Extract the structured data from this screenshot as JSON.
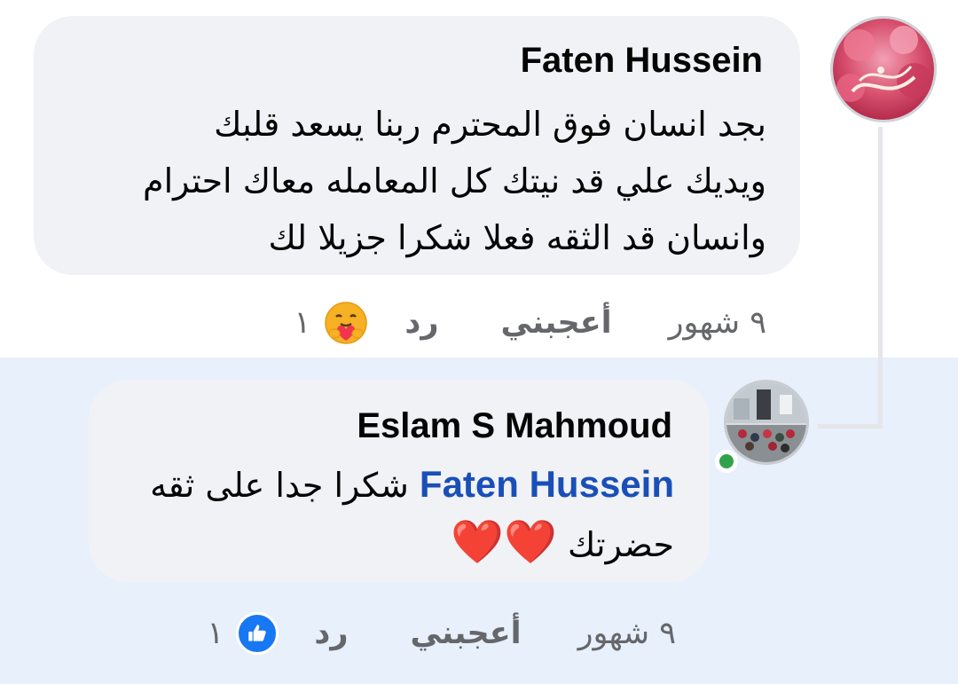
{
  "colors": {
    "bubble_bg": "#f0f2f5",
    "highlight_bg": "#e7f0fb",
    "meta_text": "#65676b",
    "mention": "#1a4fb8",
    "online": "#31a24c",
    "like_blue": "#1877f2"
  },
  "comments": [
    {
      "author": "Faten Hussein",
      "lines": [
        "بجد انسان فوق المحترم ربنا يسعد قلبك",
        "ويديك علي قد نيتك كل المعامله معاك  احترام",
        "وانسان قد الثقه فعلا شكرا جزيلا لك"
      ],
      "time": "٩ شهور",
      "like_label": "أعجبني",
      "reply_label": "رد",
      "reaction_icon": "care-reaction-icon",
      "reaction_count": "١"
    },
    {
      "author": "Eslam S Mahmoud",
      "mention": "Faten Hussein",
      "line1_text": "شكرا جدا على ثقه",
      "line2_text": "حضرتك",
      "emoji": "❤️❤️",
      "time": "٩ شهور",
      "like_label": "أعجبني",
      "reply_label": "رد",
      "reaction_icon": "like-reaction-icon",
      "reaction_count": "١",
      "online": true
    }
  ]
}
